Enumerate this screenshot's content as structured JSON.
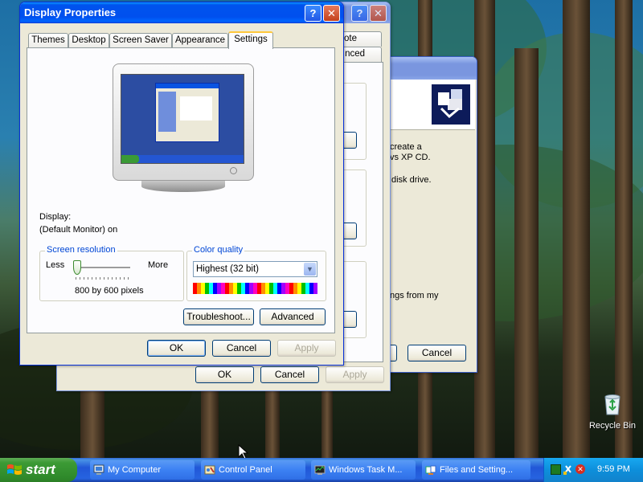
{
  "display_properties": {
    "title": "Display Properties",
    "help_icon": "?",
    "close_icon": "✕",
    "tabs": [
      "Themes",
      "Desktop",
      "Screen Saver",
      "Appearance",
      "Settings"
    ],
    "display_label": "Display:",
    "display_value": "(Default Monitor) on",
    "screen_resolution": {
      "legend": "Screen resolution",
      "less": "Less",
      "more": "More",
      "value": "800 by 600 pixels",
      "slider_position": 0
    },
    "color_quality": {
      "legend": "Color quality",
      "selected": "Highest (32 bit)"
    },
    "troubleshoot_button": "Troubleshoot...",
    "advanced_button": "Advanced",
    "ok_button": "OK",
    "cancel_button": "Cancel",
    "apply_button": "Apply"
  },
  "background_window_1": {
    "help_icon": "?",
    "close_icon": "✕",
    "tab_fragment_1": "ote",
    "tab_fragment_2": "nced",
    "ok_button": "OK",
    "cancel_button": "Cancel",
    "apply_button": "Apply"
  },
  "background_window_2": {
    "text_line_1": "create a",
    "text_line_2": "vs XP CD.",
    "text_line_3": "disk drive.",
    "text_line_4": "ngs from my",
    "cancel_button": "Cancel"
  },
  "desktop": {
    "recycle_bin_label": "Recycle Bin"
  },
  "taskbar": {
    "start_label": "start",
    "tasks": [
      {
        "label": "My Computer",
        "icon": "my-computer-icon"
      },
      {
        "label": "Control Panel",
        "icon": "control-panel-icon"
      },
      {
        "label": "Windows Task M...",
        "icon": "task-manager-icon"
      },
      {
        "label": "Files and Setting...",
        "icon": "files-settings-icon"
      }
    ],
    "clock": "9:59 PM"
  }
}
